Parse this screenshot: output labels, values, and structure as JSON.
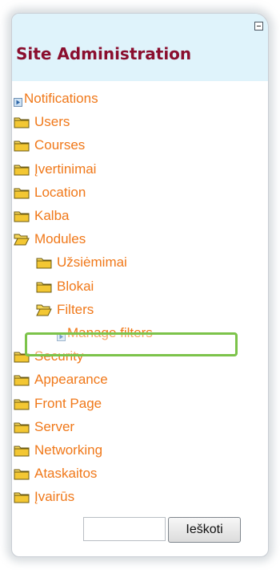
{
  "block": {
    "title": "Site Administration",
    "collapse_icon": "collapse-minus-icon"
  },
  "tree": [
    {
      "label": "Notifications",
      "icon": "leaf-arrow-icon",
      "level": 0
    },
    {
      "label": "Users",
      "icon": "folder-closed-icon",
      "level": 0
    },
    {
      "label": "Courses",
      "icon": "folder-closed-icon",
      "level": 0
    },
    {
      "label": "Įvertinimai",
      "icon": "folder-closed-icon",
      "level": 0
    },
    {
      "label": "Location",
      "icon": "folder-closed-icon",
      "level": 0
    },
    {
      "label": "Kalba",
      "icon": "folder-closed-icon",
      "level": 0
    },
    {
      "label": "Modules",
      "icon": "folder-open-icon",
      "level": 0
    },
    {
      "label": "Užsiėmimai",
      "icon": "folder-closed-icon",
      "level": 1
    },
    {
      "label": "Blokai",
      "icon": "folder-closed-icon",
      "level": 1
    },
    {
      "label": "Filters",
      "icon": "folder-open-icon",
      "level": 1
    },
    {
      "label": "Manage filters",
      "icon": "leaf-arrow-icon",
      "level": 2,
      "highlighted": true
    },
    {
      "label": "Security",
      "icon": "folder-closed-icon",
      "level": 0
    },
    {
      "label": "Appearance",
      "icon": "folder-closed-icon",
      "level": 0
    },
    {
      "label": "Front Page",
      "icon": "folder-closed-icon",
      "level": 0
    },
    {
      "label": "Server",
      "icon": "folder-closed-icon",
      "level": 0
    },
    {
      "label": "Networking",
      "icon": "folder-closed-icon",
      "level": 0
    },
    {
      "label": "Ataskaitos",
      "icon": "folder-closed-icon",
      "level": 0
    },
    {
      "label": "Įvairūs",
      "icon": "folder-closed-icon",
      "level": 0
    }
  ],
  "search": {
    "input_value": "",
    "button_label": "Ieškoti"
  },
  "colors": {
    "link": "#f07819",
    "title": "#8a0e2e",
    "header_bg": "#dff3fb",
    "highlight_border": "#7cc34a"
  }
}
